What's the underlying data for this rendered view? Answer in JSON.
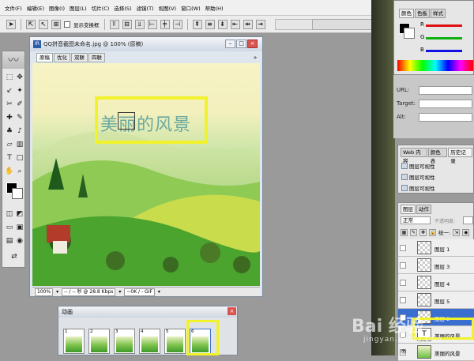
{
  "menu": {
    "items": [
      "文件(F)",
      "编辑(E)",
      "图像(I)",
      "图层(L)",
      "切片(C)",
      "选择(S)",
      "滤镜(T)",
      "视图(V)",
      "窗口(W)",
      "帮助(H)"
    ]
  },
  "options": {
    "show_transform": "显示变换框"
  },
  "document": {
    "title": "QQ拼音截图未命名.jpg @ 100% (原稿)",
    "tabs": [
      "原稿",
      "优化",
      "双联",
      "四联"
    ],
    "canvas_text": "美丽的风景",
    "zoom": "100%",
    "speed": "-- / -- 秒 @ 28.8 Kbps",
    "format": "~0K / - GIF"
  },
  "animation": {
    "title": "动画",
    "frames": [
      "1",
      "2",
      "3",
      "4",
      "5",
      "6"
    ]
  },
  "color_panel": {
    "tabs": [
      "颜色",
      "色板",
      "样式"
    ],
    "r_label": "R",
    "g_label": "G",
    "b_label": "B",
    "colors": {
      "r": "#e01010",
      "g": "#10b010",
      "b": "#1010e0"
    }
  },
  "url_panel": {
    "url_label": "URL:",
    "target_label": "Target:",
    "alt_label": "Alt:"
  },
  "history_panel": {
    "tabs": [
      "Web 内容",
      "颜色表",
      "历史记录"
    ],
    "items": [
      "图层可视性",
      "图层可视性",
      "图层可视性"
    ]
  },
  "layers_panel": {
    "tabs": [
      "图层",
      "动作"
    ],
    "mode": "正常",
    "opacity_label": "不透明度:",
    "fill_label": "统一:",
    "layers": [
      "图层 1",
      "图层 3",
      "图层 4",
      "图层 5",
      "图层 2",
      "美丽的风景",
      "美丽的风景"
    ]
  },
  "watermark": {
    "brand": "Bai 经验",
    "site": "jingyan.baidu.com"
  }
}
